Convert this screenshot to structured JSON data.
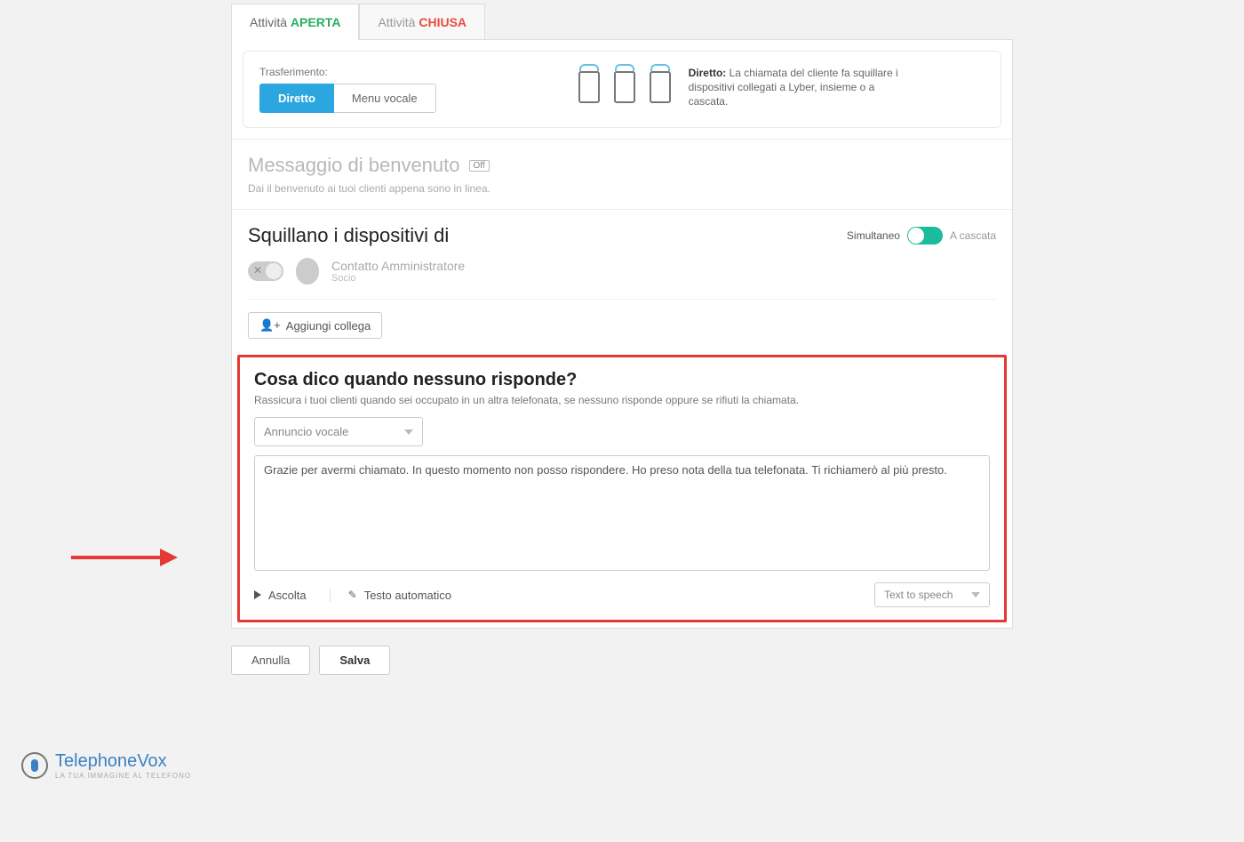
{
  "tabs": {
    "open": {
      "prefix": "Attività ",
      "status": "APERTA"
    },
    "closed": {
      "prefix": "Attività ",
      "status": "CHIUSA"
    }
  },
  "transfer": {
    "label": "Trasferimento:",
    "direct": "Diretto",
    "menu": "Menu vocale",
    "desc_bold": "Diretto:",
    "desc_rest": " La chiamata del cliente fa squillare i dispositivi collegati a Lyber, insieme o a cascata."
  },
  "welcome": {
    "title": "Messaggio di benvenuto",
    "badge": "Off",
    "subtitle": "Dai il benvenuto ai tuoi clienti appena sono in linea."
  },
  "ring": {
    "title": "Squillano i dispositivi di",
    "mode_left": "Simultaneo",
    "mode_right": "A cascata",
    "contact_name": "Contatto Amministratore",
    "contact_role": "Socio",
    "add_label": "Aggiungi collega"
  },
  "noanswer": {
    "title": "Cosa dico quando nessuno risponde?",
    "subtitle": "Rassicura i tuoi clienti quando sei occupato in un altra telefonata, se nessuno risponde oppure se rifiuti la chiamata.",
    "select": "Annuncio vocale",
    "text": "Grazie per avermi chiamato. In questo momento non posso rispondere. Ho preso nota della tua telefonata. Ti richiamerò al più presto.",
    "listen": "Ascolta",
    "autotext": "Testo automatico",
    "tts": "Text to speech"
  },
  "footer": {
    "cancel": "Annulla",
    "save": "Salva"
  },
  "brand": {
    "name_a": "Telephone",
    "name_b": "Vox",
    "tagline": "LA TUA IMMAGINE AL TELEFONO"
  },
  "colors": {
    "accent": "#2ba6de",
    "teal": "#1abc9c",
    "highlight": "#e53935",
    "open": "#27ae60",
    "closed": "#e74c3c"
  }
}
